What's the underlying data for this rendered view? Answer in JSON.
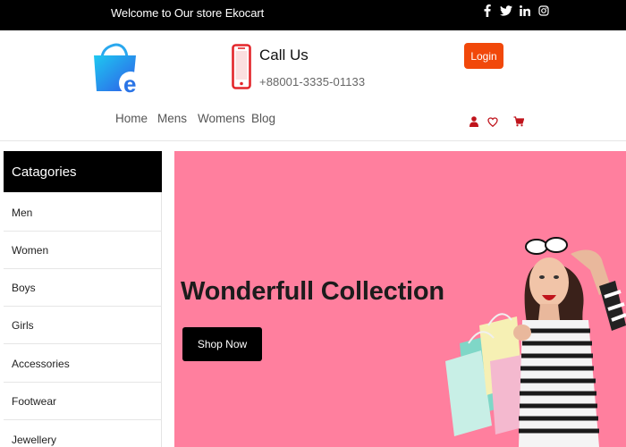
{
  "topbar": {
    "welcome_text": "Welcome to Our store Ekocart",
    "social_icons": [
      "facebook-icon",
      "twitter-icon",
      "linkedin-icon",
      "instagram-icon"
    ]
  },
  "header": {
    "logo_icon": "shopping-bag-icon",
    "call_title": "Call Us",
    "call_number": "+88001-3335-01133",
    "login_label": "Login"
  },
  "nav": {
    "links": [
      "Home",
      "Mens",
      "Womens",
      "Blog"
    ],
    "icons": [
      "user-icon",
      "heart-icon",
      "cart-icon"
    ]
  },
  "sidebar": {
    "title": "Catagories",
    "items": [
      "Men",
      "Women",
      "Boys",
      "Girls",
      "Accessories",
      "Footwear",
      "Jewellery"
    ]
  },
  "hero": {
    "title": "Wonderfull Collection",
    "button_label": "Shop Now"
  },
  "colors": {
    "topbar_bg": "#000000",
    "accent_orange": "#f1480a",
    "hero_bg": "#ff7f9e",
    "cart_red": "#c0141c"
  }
}
